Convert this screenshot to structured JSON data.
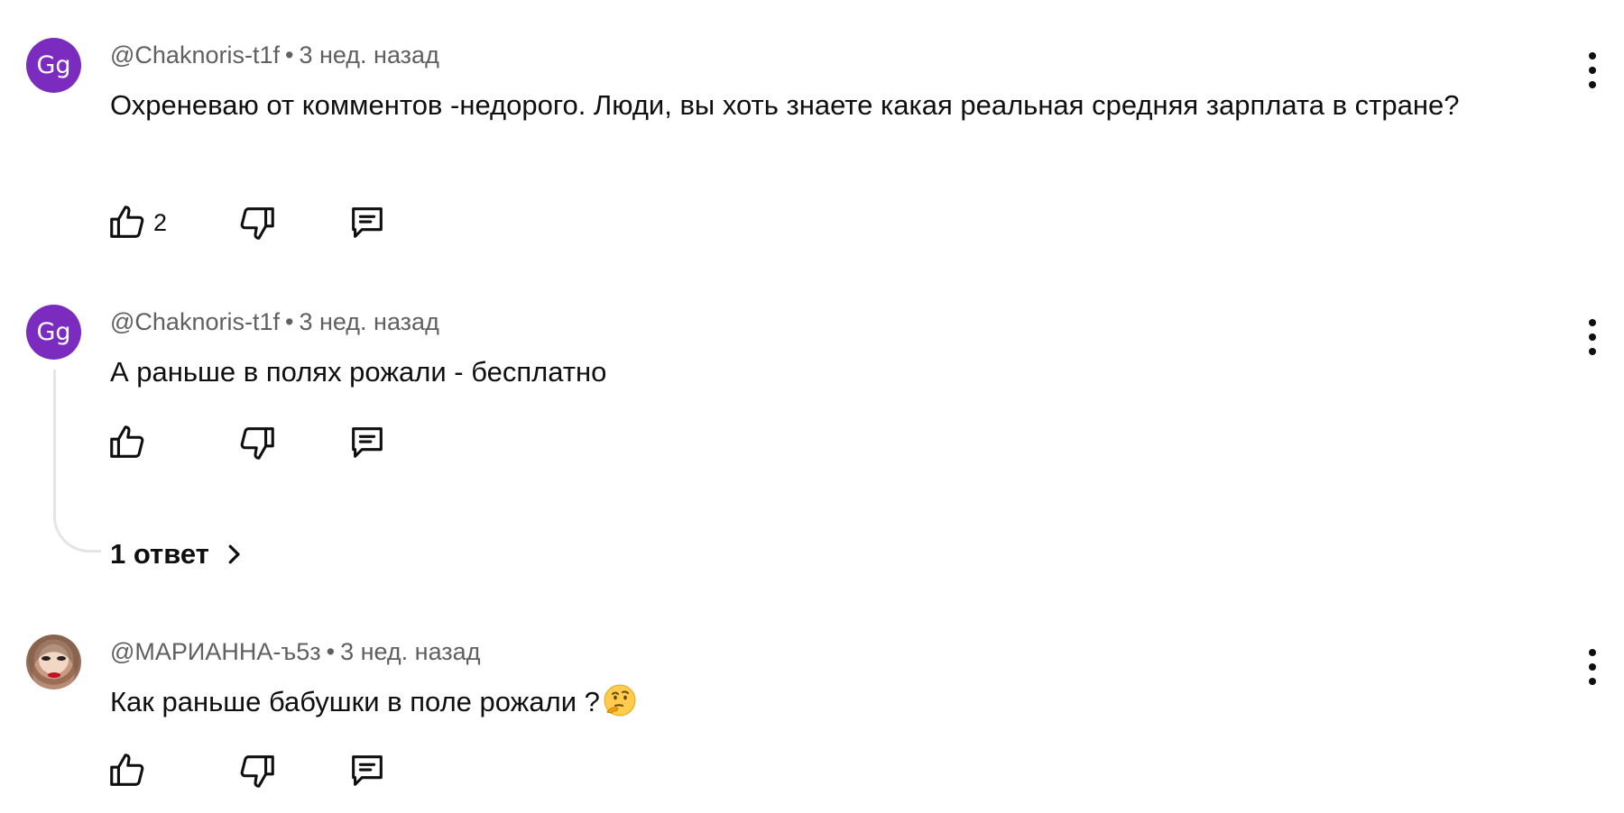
{
  "comments": [
    {
      "avatar_initials": "Gg",
      "avatar_color": "#7b2cbf",
      "author": "@Chaknoris-t1f",
      "separator": "•",
      "time": "3 нед. назад",
      "text": "Охреневаю от комментов -недорого. Люди, вы хоть знаете какая реальная средняя зарплата в стране?",
      "likes": "2"
    },
    {
      "avatar_initials": "Gg",
      "avatar_color": "#7b2cbf",
      "author": "@Chaknoris-t1f",
      "separator": "•",
      "time": "3 нед. назад",
      "text": "А раньше в полях рожали - бесплатно",
      "likes": "",
      "replies_label": "1 ответ"
    },
    {
      "avatar_initials": "",
      "author": "@МАРИАННА-ъ5з",
      "separator": "•",
      "time": "3 нед. назад",
      "text": "Как раньше бабушки в поле рожали ?",
      "emoji": "thinking-face",
      "likes": ""
    }
  ],
  "icons": {
    "like": "thumbs-up-icon",
    "dislike": "thumbs-down-icon",
    "reply": "comment-reply-icon",
    "more": "more-vertical-icon",
    "chevron": "chevron-right-icon"
  }
}
